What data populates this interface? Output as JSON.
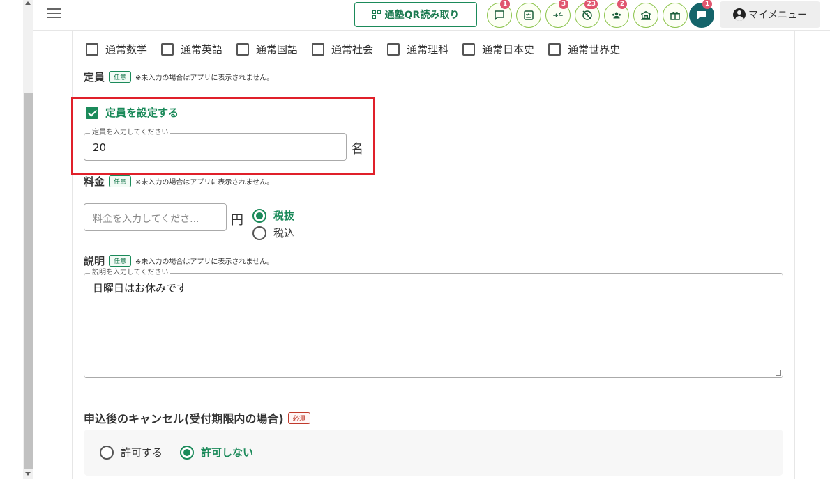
{
  "header": {
    "qr_button_label": "通塾QR読み取り",
    "badges": {
      "messages": "1",
      "transfer": "3",
      "absence": "23",
      "students": "2",
      "notification": "1"
    },
    "my_menu_label": "マイメニュー"
  },
  "subjects": [
    {
      "label": "通常数学",
      "checked": false
    },
    {
      "label": "通常英語",
      "checked": false
    },
    {
      "label": "通常国語",
      "checked": false
    },
    {
      "label": "通常社会",
      "checked": false
    },
    {
      "label": "通常理科",
      "checked": false
    },
    {
      "label": "通常日本史",
      "checked": false
    },
    {
      "label": "通常世界史",
      "checked": false
    }
  ],
  "capacity": {
    "label": "定員",
    "tag": "任意",
    "note": "※未入力の場合はアプリに表示されません。",
    "checkbox_label": "定員を設定する",
    "checkbox_checked": true,
    "input_legend": "定員を入力してください",
    "input_value": "20",
    "unit": "名"
  },
  "fee": {
    "label": "料金",
    "tag": "任意",
    "note": "※未入力の場合はアプリに表示されません。",
    "placeholder": "料金を入力してくださ...",
    "unit": "円",
    "tax_options": [
      "税抜",
      "税込"
    ],
    "tax_selected": "税抜"
  },
  "description": {
    "label": "説明",
    "tag": "任意",
    "note": "※未入力の場合はアプリに表示されません。",
    "legend": "説明を入力してください",
    "value": "日曜日はお休みです"
  },
  "cancellation": {
    "label": "申込後のキャンセル(受付期限内の場合)",
    "tag": "必須",
    "options": [
      "許可する",
      "許可しない"
    ],
    "selected": "許可しない"
  },
  "colors": {
    "accent": "#1b8a5a",
    "highlight": "#e0202a",
    "badge": "#e0566f"
  }
}
